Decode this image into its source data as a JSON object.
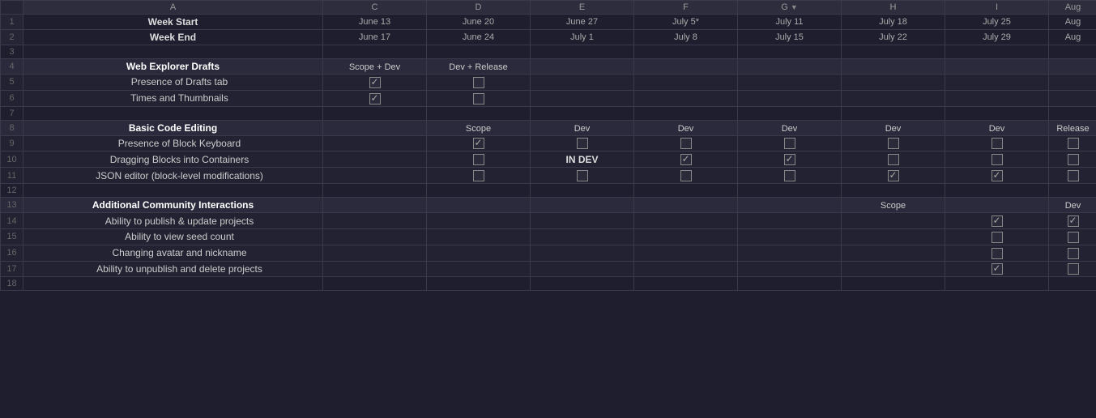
{
  "columns": {
    "rownum": "#",
    "a": "A",
    "c": "C",
    "d": "D",
    "e": "E",
    "f": "F",
    "g": "G",
    "h": "H",
    "i": "I",
    "j": "Aug"
  },
  "header": {
    "row1": {
      "label_week_start": "Week Start",
      "c_start": "June 13",
      "d_start": "June 20",
      "e_start": "June 27",
      "f_start": "July 5*",
      "g_start": "July 11",
      "h_start": "July 18",
      "i_start": "July 25",
      "j_start": "Aug"
    },
    "row2": {
      "label_week_end": "Week End",
      "c_end": "June 17",
      "d_end": "June 24",
      "e_end": "July 1",
      "f_end": "July 8",
      "g_end": "July 15",
      "h_end": "July 22",
      "i_end": "July 29",
      "j_end": "Aug"
    }
  },
  "rows": [
    {
      "num": 1,
      "type": "header_start"
    },
    {
      "num": 2,
      "type": "header_end"
    },
    {
      "num": 3,
      "type": "empty"
    },
    {
      "num": 4,
      "type": "section",
      "label": "Web Explorer Drafts",
      "c": "Scope + Dev",
      "d": "Dev + Release",
      "e": "",
      "f": "",
      "g": "",
      "h": "",
      "i": "",
      "j": ""
    },
    {
      "num": 5,
      "type": "item",
      "label": "Presence of Drafts tab",
      "c": "checked",
      "d": "unchecked",
      "e": "",
      "f": "",
      "g": "",
      "h": "",
      "i": "",
      "j": ""
    },
    {
      "num": 6,
      "type": "item",
      "label": "Times and Thumbnails",
      "c": "checked",
      "d": "unchecked",
      "e": "",
      "f": "",
      "g": "",
      "h": "",
      "i": "",
      "j": ""
    },
    {
      "num": 7,
      "type": "empty"
    },
    {
      "num": 8,
      "type": "section",
      "label": "Basic Code Editing",
      "c": "",
      "d": "Scope",
      "e": "Dev",
      "f": "Dev",
      "g": "Dev",
      "h": "Dev",
      "i": "Dev",
      "j": "Release"
    },
    {
      "num": 9,
      "type": "item",
      "label": "Presence of Block Keyboard",
      "c": "",
      "d": "checked",
      "e": "unchecked",
      "f": "unchecked",
      "g": "unchecked",
      "h": "unchecked",
      "i": "unchecked",
      "j": "unchecked"
    },
    {
      "num": 10,
      "type": "item",
      "label": "Dragging Blocks into Containers",
      "c": "",
      "d": "unchecked",
      "e": "indev",
      "f": "checked",
      "g": "checked",
      "h": "unchecked",
      "i": "unchecked",
      "j": "unchecked"
    },
    {
      "num": 11,
      "type": "item",
      "label": "JSON editor (block-level modifications)",
      "c": "",
      "d": "unchecked",
      "e": "unchecked",
      "f": "unchecked",
      "g": "unchecked",
      "h": "checked",
      "i": "checked",
      "j": "unchecked"
    },
    {
      "num": 12,
      "type": "empty"
    },
    {
      "num": 13,
      "type": "section",
      "label": "Additional Community Interactions",
      "c": "",
      "d": "",
      "e": "",
      "f": "",
      "g": "",
      "h": "Scope",
      "i": "",
      "j": "Dev"
    },
    {
      "num": 14,
      "type": "item",
      "label": "Ability to publish & update projects",
      "c": "",
      "d": "",
      "e": "",
      "f": "",
      "g": "",
      "h": "",
      "i": "checked",
      "j": "checked"
    },
    {
      "num": 15,
      "type": "item",
      "label": "Ability to view seed count",
      "c": "",
      "d": "",
      "e": "",
      "f": "",
      "g": "",
      "h": "",
      "i": "unchecked",
      "j": "unchecked"
    },
    {
      "num": 16,
      "type": "item",
      "label": "Changing avatar and nickname",
      "c": "",
      "d": "",
      "e": "",
      "f": "",
      "g": "",
      "h": "",
      "i": "unchecked",
      "j": "unchecked"
    },
    {
      "num": 17,
      "type": "item",
      "label": "Ability to unpublish and delete projects",
      "c": "",
      "d": "",
      "e": "",
      "f": "",
      "g": "",
      "h": "",
      "i": "checked",
      "j": "unchecked"
    },
    {
      "num": 18,
      "type": "empty"
    }
  ]
}
